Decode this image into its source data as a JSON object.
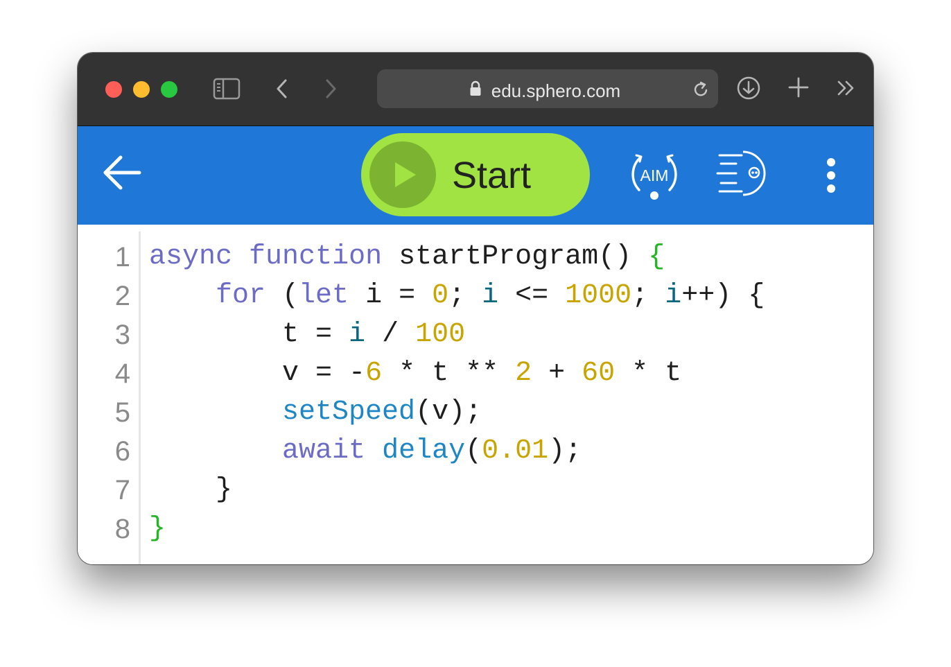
{
  "browser": {
    "url": "edu.sphero.com",
    "icons": {
      "sidebar": "sidebar-icon",
      "back": "chevron-left-icon",
      "forward": "chevron-right-icon",
      "lock": "lock-icon",
      "reload": "reload-icon",
      "download": "download-icon",
      "new_tab": "plus-icon",
      "more": "double-chevron-right-icon"
    }
  },
  "toolbar": {
    "start_label": "Start",
    "aim_label": "AIM",
    "colors": {
      "bar": "#1f78d8",
      "start_button": "#a1e342",
      "start_circle": "#7cb330"
    }
  },
  "editor": {
    "line_numbers": [
      "1",
      "2",
      "3",
      "4",
      "5",
      "6",
      "7",
      "8"
    ],
    "lines": [
      [
        {
          "t": "async",
          "c": "kw"
        },
        {
          "t": " ",
          "c": "plain"
        },
        {
          "t": "function",
          "c": "kw"
        },
        {
          "t": " startProgram() ",
          "c": "plain"
        },
        {
          "t": "{",
          "c": "brace"
        }
      ],
      [
        {
          "t": "    ",
          "c": "plain"
        },
        {
          "t": "for",
          "c": "kw"
        },
        {
          "t": " (",
          "c": "plain"
        },
        {
          "t": "let",
          "c": "kw"
        },
        {
          "t": " i = ",
          "c": "plain"
        },
        {
          "t": "0",
          "c": "num"
        },
        {
          "t": "; ",
          "c": "plain"
        },
        {
          "t": "i",
          "c": "var"
        },
        {
          "t": " <= ",
          "c": "plain"
        },
        {
          "t": "1000",
          "c": "num"
        },
        {
          "t": "; ",
          "c": "plain"
        },
        {
          "t": "i",
          "c": "var"
        },
        {
          "t": "++) {",
          "c": "plain"
        }
      ],
      [
        {
          "t": "        t = ",
          "c": "plain"
        },
        {
          "t": "i",
          "c": "var"
        },
        {
          "t": " / ",
          "c": "plain"
        },
        {
          "t": "100",
          "c": "num"
        }
      ],
      [
        {
          "t": "        v = -",
          "c": "plain"
        },
        {
          "t": "6",
          "c": "num"
        },
        {
          "t": " * t ** ",
          "c": "plain"
        },
        {
          "t": "2",
          "c": "num"
        },
        {
          "t": " + ",
          "c": "plain"
        },
        {
          "t": "60",
          "c": "num"
        },
        {
          "t": " * t",
          "c": "plain"
        }
      ],
      [
        {
          "t": "        ",
          "c": "plain"
        },
        {
          "t": "setSpeed",
          "c": "fn"
        },
        {
          "t": "(v);",
          "c": "plain"
        }
      ],
      [
        {
          "t": "        ",
          "c": "plain"
        },
        {
          "t": "await",
          "c": "kw"
        },
        {
          "t": " ",
          "c": "plain"
        },
        {
          "t": "delay",
          "c": "fn"
        },
        {
          "t": "(",
          "c": "plain"
        },
        {
          "t": "0.01",
          "c": "num"
        },
        {
          "t": ");",
          "c": "plain"
        }
      ],
      [
        {
          "t": "    }",
          "c": "plain"
        }
      ],
      [
        {
          "t": "}",
          "c": "brace"
        }
      ]
    ]
  }
}
